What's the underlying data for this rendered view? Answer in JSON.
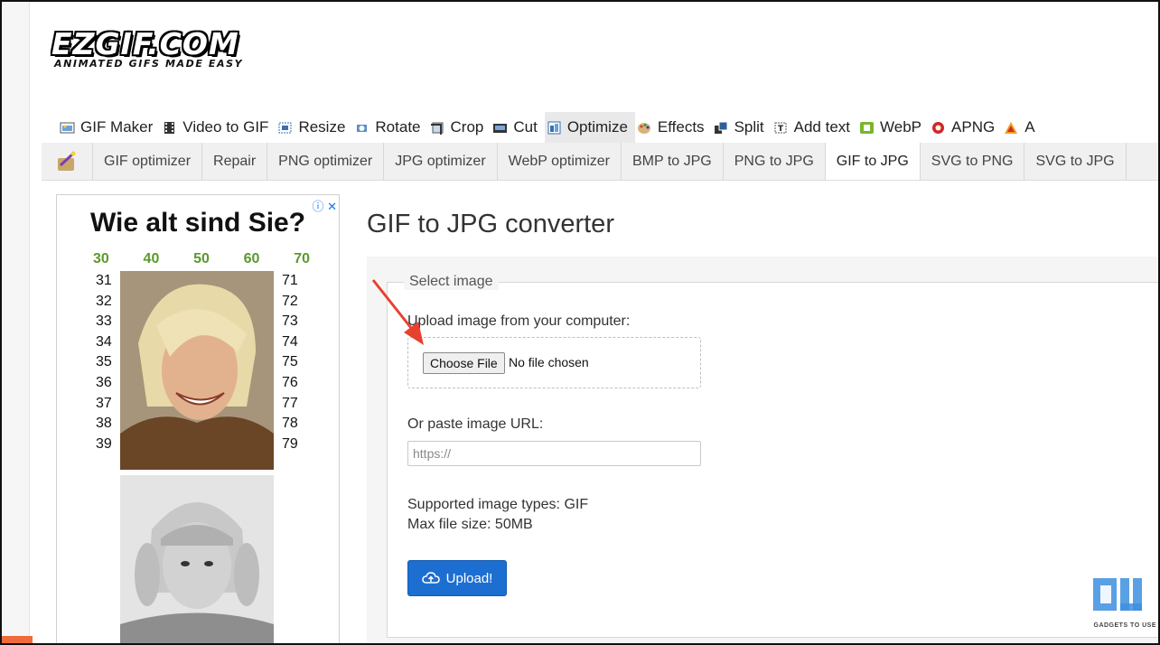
{
  "logo": {
    "main": "EZGIF.COM",
    "tagline": "ANIMATED GIFS MADE EASY"
  },
  "main_nav": [
    {
      "label": "GIF Maker",
      "icon": "image-icon"
    },
    {
      "label": "Video to GIF",
      "icon": "film-icon"
    },
    {
      "label": "Resize",
      "icon": "resize-icon"
    },
    {
      "label": "Rotate",
      "icon": "rotate-icon"
    },
    {
      "label": "Crop",
      "icon": "crop-icon"
    },
    {
      "label": "Cut",
      "icon": "cut-icon"
    },
    {
      "label": "Optimize",
      "icon": "optimize-icon",
      "active": true
    },
    {
      "label": "Effects",
      "icon": "palette-icon"
    },
    {
      "label": "Split",
      "icon": "split-icon"
    },
    {
      "label": "Add text",
      "icon": "text-icon"
    },
    {
      "label": "WebP",
      "icon": "webp-icon"
    },
    {
      "label": "APNG",
      "icon": "apng-icon"
    },
    {
      "label": "A",
      "icon": "avif-icon"
    }
  ],
  "sub_nav": [
    {
      "label": "GIF optimizer"
    },
    {
      "label": "Repair"
    },
    {
      "label": "PNG optimizer"
    },
    {
      "label": "JPG optimizer"
    },
    {
      "label": "WebP optimizer"
    },
    {
      "label": "BMP to JPG"
    },
    {
      "label": "PNG to JPG"
    },
    {
      "label": "GIF to JPG",
      "active": true
    },
    {
      "label": "SVG to PNG"
    },
    {
      "label": "SVG to JPG"
    }
  ],
  "ad": {
    "title": "Wie alt sind Sie?",
    "top_numbers": [
      "30",
      "40",
      "50",
      "60",
      "70"
    ],
    "left_numbers": [
      "31",
      "32",
      "33",
      "34",
      "35",
      "36",
      "37",
      "38",
      "39"
    ],
    "right_numbers": [
      "71",
      "72",
      "73",
      "74",
      "75",
      "76",
      "77",
      "78",
      "79"
    ]
  },
  "page": {
    "title": "GIF to JPG converter"
  },
  "form": {
    "legend": "Select image",
    "upload_label": "Upload image from your computer:",
    "choose_file": "Choose File",
    "no_file": "No file chosen",
    "url_label": "Or paste image URL:",
    "url_placeholder": "https://",
    "supported": "Supported image types: GIF",
    "max_size": "Max file size: 50MB",
    "upload_button": "Upload!"
  },
  "watermark": {
    "text": "GADGETS TO USE"
  },
  "colors": {
    "accent": "#1c6fd1",
    "nav_bg": "#f0f0f0",
    "ad_numbers": "#5a9a2a",
    "arrow": "#e8412f"
  }
}
